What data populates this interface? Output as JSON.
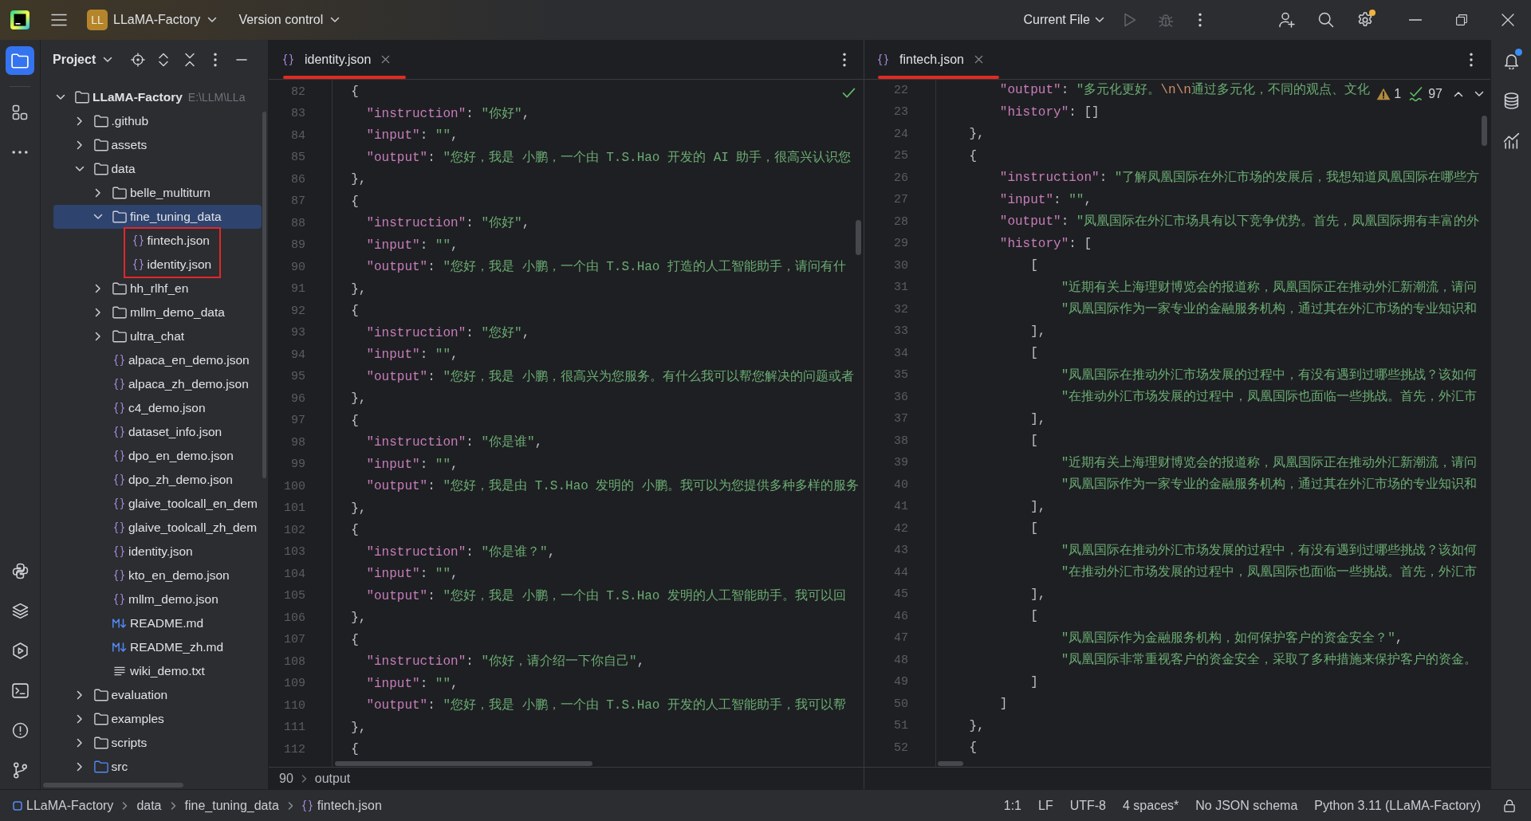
{
  "title_bar": {
    "project": {
      "badge": "LL",
      "name": "LLaMA-Factory"
    },
    "vcs": "Version control",
    "run_config": "Current File",
    "actions": [
      {
        "kind": "run",
        "disabled": true
      },
      {
        "kind": "debug",
        "disabled": true
      },
      {
        "kind": "more",
        "disabled": false
      }
    ],
    "settings_badge": true
  },
  "left_toolbar": {
    "top": [
      {
        "kind": "project",
        "selected": true
      },
      {
        "kind": "structure",
        "selected": false
      },
      {
        "kind": "more",
        "selected": false
      }
    ],
    "bottom": [
      {
        "kind": "python",
        "selected": false
      },
      {
        "kind": "layers",
        "selected": false
      },
      {
        "kind": "services",
        "selected": false
      },
      {
        "kind": "terminal",
        "selected": false
      },
      {
        "kind": "problems",
        "selected": false
      },
      {
        "kind": "git",
        "selected": false
      }
    ]
  },
  "project_panel": {
    "title": "Project",
    "tree": [
      {
        "label": "LLaMA-Factory",
        "path": "E:\\LLM\\LLa",
        "kind": "folder",
        "expanded": true,
        "selected": false,
        "marked": false,
        "children": [
          {
            "label": ".github",
            "kind": "folder",
            "expanded": false,
            "selected": false,
            "marked": false
          },
          {
            "label": "assets",
            "kind": "folder",
            "expanded": false,
            "selected": false,
            "marked": false
          },
          {
            "label": "data",
            "kind": "folder",
            "expanded": true,
            "selected": false,
            "marked": false,
            "children": [
              {
                "label": "belle_multiturn",
                "kind": "folder",
                "expanded": false,
                "selected": false,
                "marked": false
              },
              {
                "label": "fine_tuning_data",
                "kind": "folder",
                "expanded": true,
                "selected": true,
                "marked": false,
                "children": [
                  {
                    "label": "fintech.json",
                    "kind": "json",
                    "selected": false,
                    "marked": true
                  },
                  {
                    "label": "identity.json",
                    "kind": "json",
                    "selected": false,
                    "marked": true
                  }
                ]
              },
              {
                "label": "hh_rlhf_en",
                "kind": "folder",
                "expanded": false,
                "selected": false,
                "marked": false
              },
              {
                "label": "mllm_demo_data",
                "kind": "folder",
                "expanded": false,
                "selected": false,
                "marked": false
              },
              {
                "label": "ultra_chat",
                "kind": "folder",
                "expanded": false,
                "selected": false,
                "marked": false
              },
              {
                "label": "alpaca_en_demo.json",
                "kind": "json",
                "selected": false,
                "marked": false
              },
              {
                "label": "alpaca_zh_demo.json",
                "kind": "json",
                "selected": false,
                "marked": false
              },
              {
                "label": "c4_demo.json",
                "kind": "json",
                "selected": false,
                "marked": false
              },
              {
                "label": "dataset_info.json",
                "kind": "json",
                "selected": false,
                "marked": false
              },
              {
                "label": "dpo_en_demo.json",
                "kind": "json",
                "selected": false,
                "marked": false
              },
              {
                "label": "dpo_zh_demo.json",
                "kind": "json",
                "selected": false,
                "marked": false
              },
              {
                "label": "glaive_toolcall_en_dem",
                "kind": "json",
                "selected": false,
                "marked": false
              },
              {
                "label": "glaive_toolcall_zh_dem",
                "kind": "json",
                "selected": false,
                "marked": false
              },
              {
                "label": "identity.json",
                "kind": "json",
                "selected": false,
                "marked": false
              },
              {
                "label": "kto_en_demo.json",
                "kind": "json",
                "selected": false,
                "marked": false
              },
              {
                "label": "mllm_demo.json",
                "kind": "json",
                "selected": false,
                "marked": false
              },
              {
                "label": "README.md",
                "kind": "md",
                "selected": false,
                "marked": false
              },
              {
                "label": "README_zh.md",
                "kind": "md",
                "selected": false,
                "marked": false
              },
              {
                "label": "wiki_demo.txt",
                "kind": "txt",
                "selected": false,
                "marked": false
              }
            ]
          },
          {
            "label": "evaluation",
            "kind": "folder",
            "expanded": false,
            "selected": false,
            "marked": false
          },
          {
            "label": "examples",
            "kind": "folder",
            "expanded": false,
            "selected": false,
            "marked": false
          },
          {
            "label": "scripts",
            "kind": "folder",
            "expanded": false,
            "selected": false,
            "marked": false
          },
          {
            "label": "src",
            "kind": "source_folder",
            "expanded": false,
            "selected": false,
            "marked": false
          }
        ]
      }
    ]
  },
  "editors": [
    {
      "tab": {
        "label": "identity.json",
        "kind": "json",
        "selected": true,
        "marked": true
      },
      "inspection": {
        "kind": "ok"
      },
      "lines": [
        {
          "number": "82",
          "text": "  {"
        },
        {
          "number": "83",
          "text": "    \"instruction\": \"你好\","
        },
        {
          "number": "84",
          "text": "    \"input\": \"\","
        },
        {
          "number": "85",
          "text": "    \"output\": \"您好，我是 小鹏，一个由 T.S.Hao 开发的 AI 助手，很高兴认识您"
        },
        {
          "number": "86",
          "text": "  },"
        },
        {
          "number": "87",
          "text": "  {"
        },
        {
          "number": "88",
          "text": "    \"instruction\": \"你好\","
        },
        {
          "number": "89",
          "text": "    \"input\": \"\","
        },
        {
          "number": "90",
          "text": "    \"output\": \"您好，我是 小鹏，一个由 T.S.Hao 打造的人工智能助手，请问有什"
        },
        {
          "number": "91",
          "text": "  },"
        },
        {
          "number": "92",
          "text": "  {"
        },
        {
          "number": "93",
          "text": "    \"instruction\": \"您好\","
        },
        {
          "number": "94",
          "text": "    \"input\": \"\","
        },
        {
          "number": "95",
          "text": "    \"output\": \"您好，我是 小鹏，很高兴为您服务。有什么我可以帮您解决的问题或者"
        },
        {
          "number": "96",
          "text": "  },"
        },
        {
          "number": "97",
          "text": "  {"
        },
        {
          "number": "98",
          "text": "    \"instruction\": \"你是谁\","
        },
        {
          "number": "99",
          "text": "    \"input\": \"\","
        },
        {
          "number": "100",
          "text": "    \"output\": \"您好，我是由 T.S.Hao 发明的 小鹏。我可以为您提供多种多样的服务"
        },
        {
          "number": "101",
          "text": "  },"
        },
        {
          "number": "102",
          "text": "  {"
        },
        {
          "number": "103",
          "text": "    \"instruction\": \"你是谁？\","
        },
        {
          "number": "104",
          "text": "    \"input\": \"\","
        },
        {
          "number": "105",
          "text": "    \"output\": \"您好，我是 小鹏，一个由 T.S.Hao 发明的人工智能助手。我可以回"
        },
        {
          "number": "106",
          "text": "  },"
        },
        {
          "number": "107",
          "text": "  {"
        },
        {
          "number": "108",
          "text": "    \"instruction\": \"你好，请介绍一下你自己\","
        },
        {
          "number": "109",
          "text": "    \"input\": \"\","
        },
        {
          "number": "110",
          "text": "    \"output\": \"您好，我是 小鹏，一个由 T.S.Hao 开发的人工智能助手，我可以帮"
        },
        {
          "number": "111",
          "text": "  },"
        },
        {
          "number": "112",
          "text": "  {"
        }
      ],
      "breadcrumb": [
        "90",
        "output"
      ]
    },
    {
      "tab": {
        "label": "fintech.json",
        "kind": "json",
        "selected": true,
        "marked": true
      },
      "inspection": {
        "kind": "counts",
        "warnings": "1",
        "passed": "97"
      },
      "lines": [
        {
          "number": "22",
          "text": "        \"output\": \"多元化更好。\\n\\n通过多元化，不同的观点、文化"
        },
        {
          "number": "23",
          "text": "        \"history\": []"
        },
        {
          "number": "24",
          "text": "    },"
        },
        {
          "number": "25",
          "text": "    {"
        },
        {
          "number": "26",
          "text": "        \"instruction\": \"了解凤凰国际在外汇市场的发展后，我想知道凤凰国际在哪些方"
        },
        {
          "number": "27",
          "text": "        \"input\": \"\","
        },
        {
          "number": "28",
          "text": "        \"output\": \"凤凰国际在外汇市场具有以下竞争优势。首先，凤凰国际拥有丰富的外"
        },
        {
          "number": "29",
          "text": "        \"history\": ["
        },
        {
          "number": "30",
          "text": "            ["
        },
        {
          "number": "31",
          "text": "                \"近期有关上海理财博览会的报道称，凤凰国际正在推动外汇新潮流，请问"
        },
        {
          "number": "32",
          "text": "                \"凤凰国际作为一家专业的金融服务机构，通过其在外汇市场的专业知识和"
        },
        {
          "number": "33",
          "text": "            ],"
        },
        {
          "number": "34",
          "text": "            ["
        },
        {
          "number": "35",
          "text": "                \"凤凰国际在推动外汇市场发展的过程中，有没有遇到过哪些挑战？该如何"
        },
        {
          "number": "36",
          "text": "                \"在推动外汇市场发展的过程中，凤凰国际也面临一些挑战。首先，外汇市"
        },
        {
          "number": "37",
          "text": "            ],"
        },
        {
          "number": "38",
          "text": "            ["
        },
        {
          "number": "39",
          "text": "                \"近期有关上海理财博览会的报道称，凤凰国际正在推动外汇新潮流，请问"
        },
        {
          "number": "40",
          "text": "                \"凤凰国际作为一家专业的金融服务机构，通过其在外汇市场的专业知识和"
        },
        {
          "number": "41",
          "text": "            ],"
        },
        {
          "number": "42",
          "text": "            ["
        },
        {
          "number": "43",
          "text": "                \"凤凰国际在推动外汇市场发展的过程中，有没有遇到过哪些挑战？该如何"
        },
        {
          "number": "44",
          "text": "                \"在推动外汇市场发展的过程中，凤凰国际也面临一些挑战。首先，外汇市"
        },
        {
          "number": "45",
          "text": "            ],"
        },
        {
          "number": "46",
          "text": "            ["
        },
        {
          "number": "47",
          "text": "                \"凤凰国际作为金融服务机构，如何保护客户的资金安全？\","
        },
        {
          "number": "48",
          "text": "                \"凤凰国际非常重视客户的资金安全，采取了多种措施来保护客户的资金。"
        },
        {
          "number": "49",
          "text": "            ]"
        },
        {
          "number": "50",
          "text": "        ]"
        },
        {
          "number": "51",
          "text": "    },"
        },
        {
          "number": "52",
          "text": "    {"
        }
      ]
    }
  ],
  "right_toolbar": [
    {
      "kind": "notifications",
      "badge": true
    },
    {
      "kind": "database",
      "badge": false
    },
    {
      "kind": "chart",
      "badge": false
    }
  ],
  "status_bar": {
    "path": [
      {
        "label": "LLaMA-Factory",
        "kind": "module"
      },
      {
        "label": "data",
        "kind": "folder"
      },
      {
        "label": "fine_tuning_data",
        "kind": "folder"
      },
      {
        "label": "fintech.json",
        "kind": "json"
      }
    ],
    "items": [
      "1:1",
      "LF",
      "UTF-8",
      "4 spaces*",
      "No JSON schema",
      "Python 3.11 (LLaMA-Factory)"
    ]
  }
}
